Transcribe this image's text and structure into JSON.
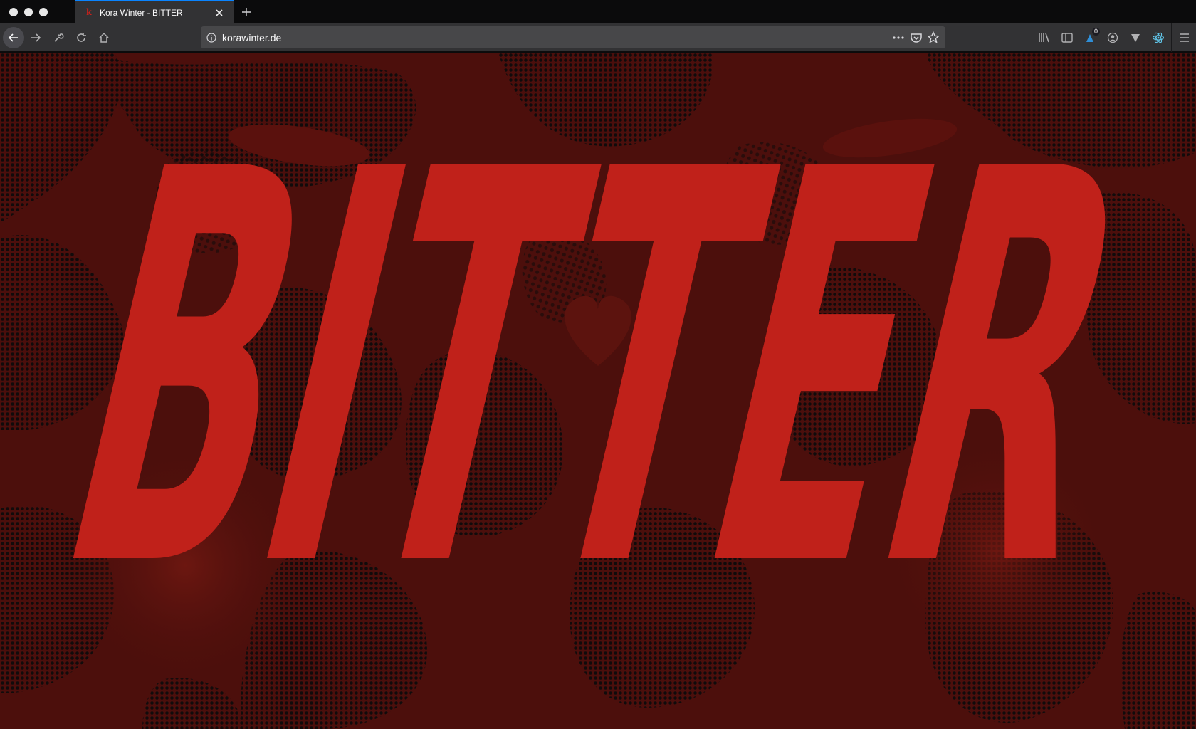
{
  "browser": {
    "tab": {
      "title": "Kora Winter - BITTER",
      "favicon": "k"
    },
    "url": "korawinter.de",
    "badge_count": "0"
  },
  "page": {
    "headline": "BITTER",
    "colors": {
      "headline": "#c0211a",
      "background_dark": "#0c0b0b",
      "background_red": "#4d0f0c"
    }
  }
}
